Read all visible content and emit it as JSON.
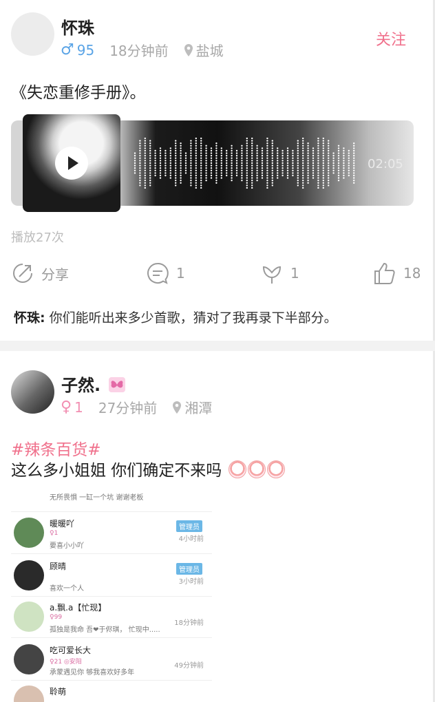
{
  "posts": [
    {
      "username": "怀珠",
      "gender_symbol": "♂",
      "gender_count": "95",
      "time": "18分钟前",
      "location": "盐城",
      "follow_label": "关注",
      "text": "《失恋重修手册》。",
      "audio_duration": "02:05",
      "play_count": "播放27次",
      "actions": {
        "share_label": "分享",
        "comment_count": "1",
        "gift_count": "1",
        "like_count": "18"
      },
      "caption_author": "怀珠:",
      "caption_text": "你们能听出来多少首歌，猜对了我再录下半部分。"
    },
    {
      "username": "子然.",
      "gender_symbol": "♀",
      "gender_count": "1",
      "time": "27分钟前",
      "location": "湘潭",
      "hashtag": "#辣条百货#",
      "text": "这么多小姐姐 你们确定不来吗",
      "screenshot_rows": [
        {
          "name": "",
          "sub1": "",
          "sub2": "无所畏惧  一缸一个坑  谢谢老板",
          "time": "",
          "badge": ""
        },
        {
          "name": "暖暖吖",
          "sub1": "♀1",
          "sub2": "要喜小小吖",
          "time": "4小时前",
          "badge": "管理员"
        },
        {
          "name": "顾晴",
          "sub1": "",
          "sub2": "喜欢一个人",
          "time": "3小时前",
          "badge": "管理员"
        },
        {
          "name": "a.飘.a【忙现】",
          "sub1": "♀99",
          "sub2": "孤独是我命   吾❤于侭琪，  忙现中.....",
          "time": "18分钟前",
          "badge": ""
        },
        {
          "name": "吃可爱长大",
          "sub1": "♀21  ◎安阳",
          "sub2": "承蒙遇见你  够我喜欢好多年",
          "time": "49分钟前",
          "badge": ""
        },
        {
          "name": "聆萌",
          "sub1": "",
          "sub2": "",
          "time": "",
          "badge": ""
        }
      ]
    }
  ],
  "colors": {
    "accent_pink": "#f0718c",
    "male_blue": "#5aa4e6",
    "female_pink": "#f28fb2"
  }
}
